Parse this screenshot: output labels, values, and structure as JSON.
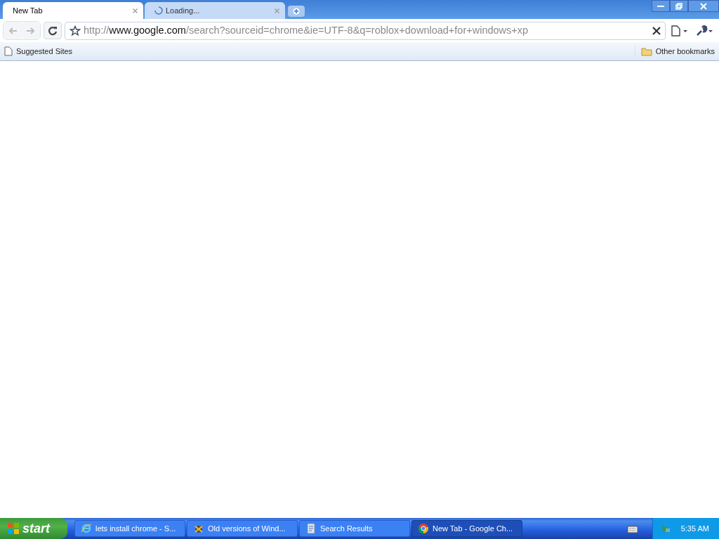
{
  "tabs": [
    {
      "label": "New Tab",
      "selected": true,
      "loading": false
    },
    {
      "label": "Loading...",
      "selected": false,
      "loading": true
    }
  ],
  "address_bar": {
    "scheme": "http://",
    "host": "www.google.com",
    "path": "/search?sourceid=chrome&ie=UTF-8&q=roblox+download+for+windows+xp"
  },
  "bookmarks": {
    "left": "Suggested Sites",
    "right": "Other bookmarks"
  },
  "taskbar": {
    "start": "start",
    "buttons": [
      {
        "label": "lets install chrome - S...",
        "kind": "ie",
        "selected": false
      },
      {
        "label": "Old versions of Wind...",
        "kind": "app",
        "selected": false
      },
      {
        "label": "Search Results",
        "kind": "doc",
        "selected": false
      },
      {
        "label": "New Tab - Google Ch...",
        "kind": "chrome",
        "selected": true
      }
    ],
    "clock": "5:35 AM"
  }
}
